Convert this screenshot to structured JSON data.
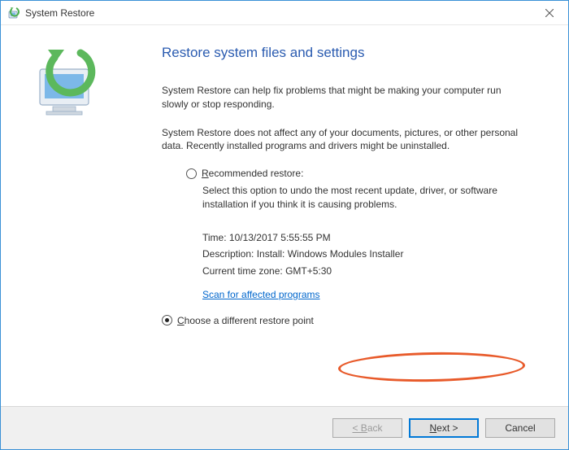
{
  "window": {
    "title": "System Restore",
    "close_label": "Close"
  },
  "main": {
    "heading": "Restore system files and settings",
    "para1": "System Restore can help fix problems that might be making your computer run slowly or stop responding.",
    "para2": "System Restore does not affect any of your documents, pictures, or other personal data. Recently installed programs and drivers might be uninstalled."
  },
  "options": {
    "recommended_label": "Recommended restore:",
    "recommended_desc": "Select this option to undo the most recent update, driver, or software installation if you think it is causing problems.",
    "details": {
      "time_label": "Time:",
      "time_value": "10/13/2017 5:55:55 PM",
      "desc_label": "Description:",
      "desc_value": "Install: Windows Modules Installer",
      "tz_label": "Current time zone:",
      "tz_value": "GMT+5:30"
    },
    "scan_link": "Scan for affected programs",
    "choose_different_label": "Choose a different restore point"
  },
  "footer": {
    "back": "< Back",
    "next": "Next >",
    "cancel": "Cancel"
  }
}
